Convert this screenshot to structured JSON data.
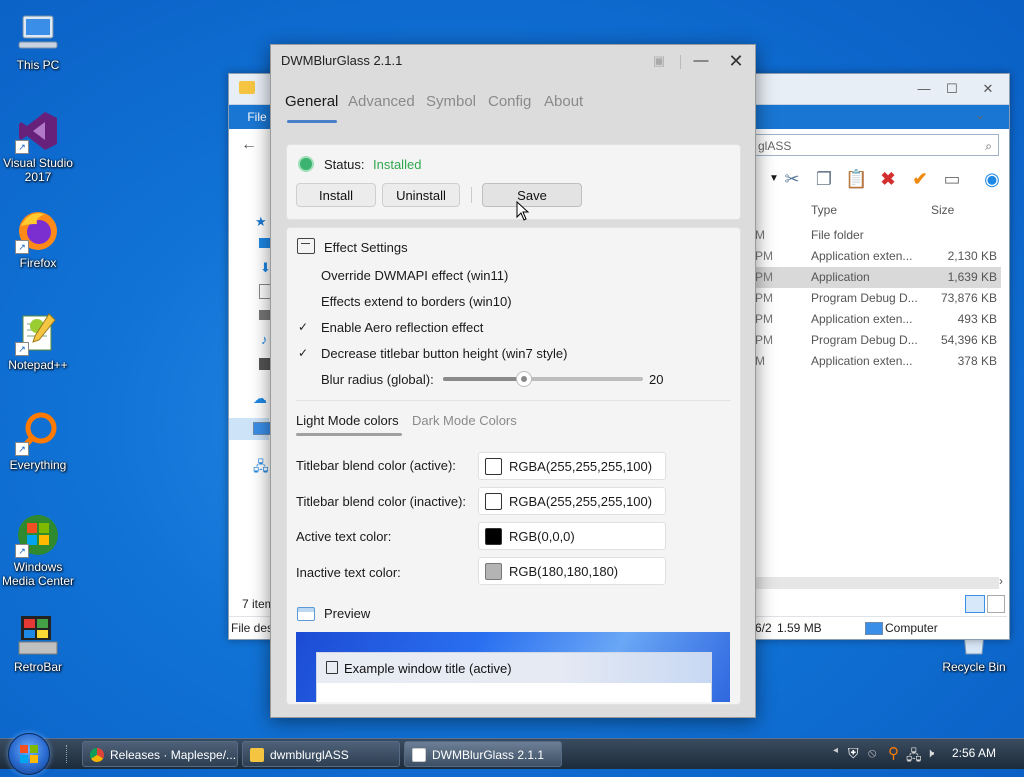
{
  "desktop": {
    "icons": [
      {
        "label": "This PC"
      },
      {
        "label": "Visual Studio 2017"
      },
      {
        "label": "Firefox"
      },
      {
        "label": "Notepad++"
      },
      {
        "label": "Everything"
      },
      {
        "label": "Windows Media Center"
      },
      {
        "label": "RetroBar"
      },
      {
        "label": "Recycle Bin"
      }
    ]
  },
  "explorer": {
    "ribbon_file": "File",
    "search_text": "glASS",
    "headers": {
      "type": "Type",
      "size": "Size"
    },
    "rows": [
      {
        "mod": "M",
        "type": "File folder",
        "size": ""
      },
      {
        "mod": "PM",
        "type": "Application exten...",
        "size": "2,130 KB"
      },
      {
        "mod": "PM",
        "type": "Application",
        "size": "1,639 KB"
      },
      {
        "mod": "PM",
        "type": "Program Debug D...",
        "size": "73,876 KB"
      },
      {
        "mod": "PM",
        "type": "Application exten...",
        "size": "493 KB"
      },
      {
        "mod": "PM",
        "type": "Program Debug D...",
        "size": "54,396 KB"
      },
      {
        "mod": "M",
        "type": "Application exten...",
        "size": "378 KB"
      }
    ],
    "items_count": "7 item",
    "status_left": "File des",
    "status_date": "6/2",
    "status_size": "1.59 MB",
    "status_location": "Computer"
  },
  "dwm": {
    "title": "DWMBlurGlass 2.1.1",
    "tabs": [
      "General",
      "Advanced",
      "Symbol",
      "Config",
      "About"
    ],
    "status_label": "Status:",
    "status_value": "Installed",
    "buttons": {
      "install": "Install",
      "uninstall": "Uninstall",
      "save": "Save"
    },
    "effect_settings_title": "Effect Settings",
    "options": [
      {
        "label": "Override DWMAPI effect (win11)",
        "checked": false
      },
      {
        "label": "Effects extend to borders (win10)",
        "checked": false
      },
      {
        "label": "Enable Aero reflection effect",
        "checked": true
      },
      {
        "label": "Decrease titlebar button height (win7 style)",
        "checked": true
      }
    ],
    "blur_label": "Blur radius (global):",
    "blur_value": "20",
    "color_tabs": [
      "Light Mode colors",
      "Dark Mode Colors"
    ],
    "colors": [
      {
        "label": "Titlebar blend color (active):",
        "value": "RGBA(255,255,255,100)",
        "swatch": "#ffffff"
      },
      {
        "label": "Titlebar blend color (inactive):",
        "value": "RGBA(255,255,255,100)",
        "swatch": "#ffffff"
      },
      {
        "label": "Active text color:",
        "value": "RGB(0,0,0)",
        "swatch": "#000000"
      },
      {
        "label": "Inactive text color:",
        "value": "RGB(180,180,180)",
        "swatch": "#b4b4b4"
      }
    ],
    "preview_label": "Preview",
    "preview_window_title": "Example window title (active)"
  },
  "taskbar": {
    "items": [
      {
        "label": "Releases · Maplespe/..."
      },
      {
        "label": "dwmblurglASS"
      },
      {
        "label": "DWMBlurGlass 2.1.1"
      }
    ],
    "clock": "2:56 AM"
  }
}
